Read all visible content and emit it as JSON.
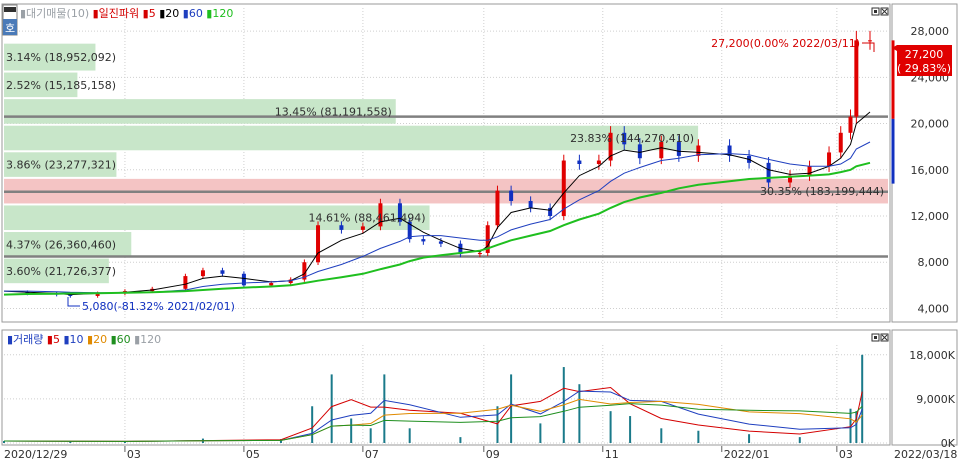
{
  "price_panel": {
    "corner_label": "호",
    "legend": [
      {
        "text": "대기매물(10)",
        "color": "#9aa0a6"
      },
      {
        "text": "일진파워",
        "color": "#d40000"
      },
      {
        "text": "5",
        "color": "#d40000"
      },
      {
        "text": "20",
        "color": "#000000"
      },
      {
        "text": "60",
        "color": "#1f3fbf"
      },
      {
        "text": "120",
        "color": "#1fbf1f"
      }
    ],
    "y_ticks": [
      "28,000",
      "24,000",
      "20,000",
      "16,000",
      "12,000",
      "8,000",
      "4,000"
    ],
    "max_annotation": "27,200(0.00% 2022/03/11)",
    "min_annotation": "5,080(-81.32% 2021/02/01)",
    "current_price": "27,200",
    "current_change": "( 29.83%)"
  },
  "volume_panel": {
    "legend": [
      {
        "text": "거래량",
        "color": "#1f3fbf"
      },
      {
        "text": "5",
        "color": "#d40000"
      },
      {
        "text": "10",
        "color": "#1f3fbf"
      },
      {
        "text": "20",
        "color": "#e08a00"
      },
      {
        "text": "60",
        "color": "#1f8f1f"
      },
      {
        "text": "120",
        "color": "#9aa0a6"
      }
    ],
    "y_ticks": [
      "18,000K",
      "9,000K",
      "0K"
    ]
  },
  "x_ticks": [
    "2020/12/29",
    "03",
    "05",
    "07",
    "09",
    "11",
    "2022/01",
    "03",
    "2022/03/18"
  ],
  "colors": {
    "up": "#e00000",
    "down": "#1030c0",
    "volume_profile_green": "#c8e6c9",
    "volume_profile_red": "#f4c4c4",
    "grid": "#cfcfcf",
    "level_line": "#808080"
  },
  "chart_data": {
    "type": "candlestick",
    "title": "일진파워",
    "x_range": [
      "2020/12/29",
      "2022/03/18"
    ],
    "ylim": [
      3000,
      30000
    ],
    "grid": true,
    "legend_position": "top-left",
    "price_series": {
      "dates": [
        "2020-12-29",
        "2021-01-10",
        "2021-01-25",
        "2021-02-01",
        "2021-02-15",
        "2021-03-01",
        "2021-03-15",
        "2021-04-01",
        "2021-04-10",
        "2021-04-20",
        "2021-05-01",
        "2021-05-15",
        "2021-05-25",
        "2021-06-01",
        "2021-06-08",
        "2021-06-20",
        "2021-07-01",
        "2021-07-10",
        "2021-07-20",
        "2021-07-25",
        "2021-08-01",
        "2021-08-10",
        "2021-08-20",
        "2021-08-30",
        "2021-09-03",
        "2021-09-08",
        "2021-09-15",
        "2021-09-25",
        "2021-10-05",
        "2021-10-12",
        "2021-10-20",
        "2021-10-30",
        "2021-11-05",
        "2021-11-12",
        "2021-11-20",
        "2021-12-01",
        "2021-12-10",
        "2021-12-20",
        "2022-01-05",
        "2022-01-15",
        "2022-01-25",
        "2022-02-05",
        "2022-02-15",
        "2022-02-25",
        "2022-03-03",
        "2022-03-08",
        "2022-03-11",
        "2022-03-18"
      ],
      "close": [
        5400,
        5300,
        5200,
        5080,
        5300,
        5500,
        5700,
        6800,
        7300,
        7000,
        6000,
        6200,
        6500,
        8000,
        11200,
        10800,
        11100,
        13100,
        11500,
        10000,
        9800,
        9600,
        8700,
        8800,
        11200,
        14200,
        13300,
        12700,
        12000,
        16800,
        16500,
        16800,
        19200,
        18200,
        17000,
        18400,
        17200,
        18100,
        17200,
        16600,
        14900,
        15500,
        16300,
        17500,
        19200,
        20600,
        27200,
        27200
      ]
    },
    "moving_averages": {
      "ma20_close": [
        5500,
        5400,
        5300,
        5200,
        5300,
        5400,
        5600,
        6100,
        6600,
        6800,
        6600,
        6300,
        6400,
        7000,
        8800,
        9900,
        10500,
        11500,
        11800,
        11300,
        10600,
        9900,
        9200,
        8900,
        9400,
        11000,
        12300,
        12700,
        12500,
        14000,
        15500,
        16300,
        17200,
        17700,
        17500,
        17900,
        17600,
        17500,
        17300,
        16900,
        16000,
        15600,
        15700,
        16300,
        17000,
        18200,
        20000,
        21000
      ],
      "ma60_close": [
        5500,
        5500,
        5450,
        5400,
        5350,
        5350,
        5400,
        5600,
        5900,
        6100,
        6200,
        6300,
        6400,
        6700,
        7200,
        7800,
        8500,
        9200,
        9800,
        10200,
        10300,
        10300,
        10100,
        9900,
        9900,
        10200,
        10800,
        11300,
        11700,
        12600,
        13400,
        14200,
        15000,
        15700,
        16200,
        16800,
        17000,
        17300,
        17400,
        17300,
        16900,
        16500,
        16300,
        16300,
        16500,
        17000,
        17800,
        18400
      ],
      "ma120_close": [
        5200,
        5250,
        5280,
        5300,
        5320,
        5350,
        5400,
        5500,
        5600,
        5700,
        5800,
        5900,
        6000,
        6200,
        6400,
        6700,
        7000,
        7400,
        7800,
        8100,
        8400,
        8600,
        8800,
        9000,
        9200,
        9500,
        9900,
        10300,
        10700,
        11200,
        11700,
        12200,
        12700,
        13200,
        13600,
        14000,
        14400,
        14700,
        15000,
        15200,
        15300,
        15400,
        15500,
        15600,
        15800,
        16000,
        16300,
        16600
      ]
    },
    "volume_profile": [
      {
        "label": "3.14% (18,952,092)",
        "low": 24500,
        "high": 27000,
        "color": "green"
      },
      {
        "label": "2.52% (15,185,158)",
        "low": 22200,
        "high": 24500,
        "color": "green"
      },
      {
        "label": "13.45% (81,191,558)",
        "low": 19900,
        "high": 22200,
        "color": "green"
      },
      {
        "label": "23.83% (144,270,410)",
        "low": 17600,
        "high": 19900,
        "color": "green"
      },
      {
        "label": "3.86% (23,277,321)",
        "low": 15300,
        "high": 17600,
        "color": "green"
      },
      {
        "label": "30.35% (183,199,444)",
        "low": 13000,
        "high": 15300,
        "color": "red"
      },
      {
        "label": "14.61% (88,461,494)",
        "low": 10700,
        "high": 13000,
        "color": "green"
      },
      {
        "label": "4.37% (26,360,460)",
        "low": 8400,
        "high": 10700,
        "color": "green"
      },
      {
        "label": "3.60% (21,726,377)",
        "low": 6100,
        "high": 8400,
        "color": "green"
      }
    ],
    "support_resistance_levels": [
      20600,
      14100,
      8500
    ],
    "annotations": [
      {
        "text": "27,200(0.00% 2022/03/11)",
        "date": "2022-03-11",
        "value": 27200
      },
      {
        "text": "5,080(-81.32% 2021/02/01)",
        "date": "2021-02-01",
        "value": 5080
      }
    ],
    "volume": {
      "ylim": [
        0,
        20000
      ],
      "unit": "K",
      "dates": [
        "2020-12-29",
        "2021-02-01",
        "2021-03-01",
        "2021-04-10",
        "2021-05-20",
        "2021-06-05",
        "2021-06-15",
        "2021-06-25",
        "2021-07-05",
        "2021-07-12",
        "2021-07-25",
        "2021-08-20",
        "2021-09-08",
        "2021-09-15",
        "2021-09-30",
        "2021-10-12",
        "2021-10-20",
        "2021-11-05",
        "2021-11-15",
        "2021-12-01",
        "2021-12-20",
        "2022-01-15",
        "2022-02-10",
        "2022-03-08",
        "2022-03-11",
        "2022-03-14"
      ],
      "values": [
        400,
        300,
        300,
        900,
        800,
        7500,
        14000,
        5000,
        3000,
        14000,
        3000,
        1200,
        7500,
        14000,
        4000,
        15500,
        12000,
        6500,
        5500,
        3000,
        2500,
        1800,
        1200,
        7000,
        6500,
        18000
      ]
    }
  }
}
